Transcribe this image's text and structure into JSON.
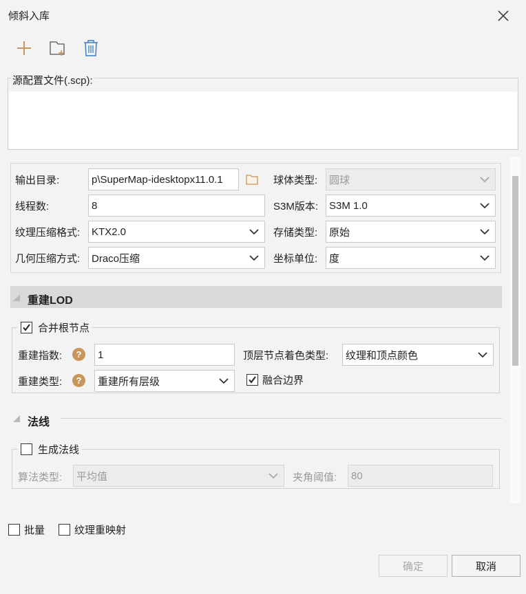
{
  "window": {
    "title": "倾斜入库"
  },
  "icons": {
    "add": "plus-icon",
    "folder_add": "new-folder-icon",
    "delete": "trash-icon",
    "close": "close-icon",
    "help": "help-icon"
  },
  "source": {
    "label": "源配置文件(.scp):"
  },
  "params": {
    "output_dir_label": "输出目录:",
    "output_dir_value": "p\\SuperMap-idesktopx11.0.1",
    "sphere_label": "球体类型:",
    "sphere_value": "圆球",
    "threads_label": "线程数:",
    "threads_value": "8",
    "s3m_label": "S3M版本:",
    "s3m_value": "S3M 1.0",
    "texture_label": "纹理压缩格式:",
    "texture_value": "KTX2.0",
    "storage_label": "存储类型:",
    "storage_value": "原始",
    "geometry_label": "几何压缩方式:",
    "geometry_value": "Draco压缩",
    "coord_label": "坐标单位:",
    "coord_value": "度"
  },
  "lod": {
    "title": "重建LOD",
    "merge_label": "合并根节点",
    "merge_checked": true,
    "index_label": "重建指数:",
    "index_value": "1",
    "top_color_label": "顶层节点着色类型:",
    "top_color_value": "纹理和顶点颜色",
    "type_label": "重建类型:",
    "type_value": "重建所有层级",
    "fuse_label": "融合边界",
    "fuse_checked": true,
    "help_glyph": "?"
  },
  "normal": {
    "title": "法线",
    "gen_label": "生成法线",
    "gen_checked": false,
    "algo_label": "算法类型:",
    "algo_value": "平均值",
    "angle_label": "夹角阈值:",
    "angle_value": "80"
  },
  "footer": {
    "batch_label": "批量",
    "remap_label": "纹理重映射",
    "ok_label": "确定",
    "cancel_label": "取消"
  },
  "colors": {
    "accent_icon": "#c8955a",
    "trash_icon": "#3a7fc4",
    "section_bg": "#d9d9d9"
  }
}
